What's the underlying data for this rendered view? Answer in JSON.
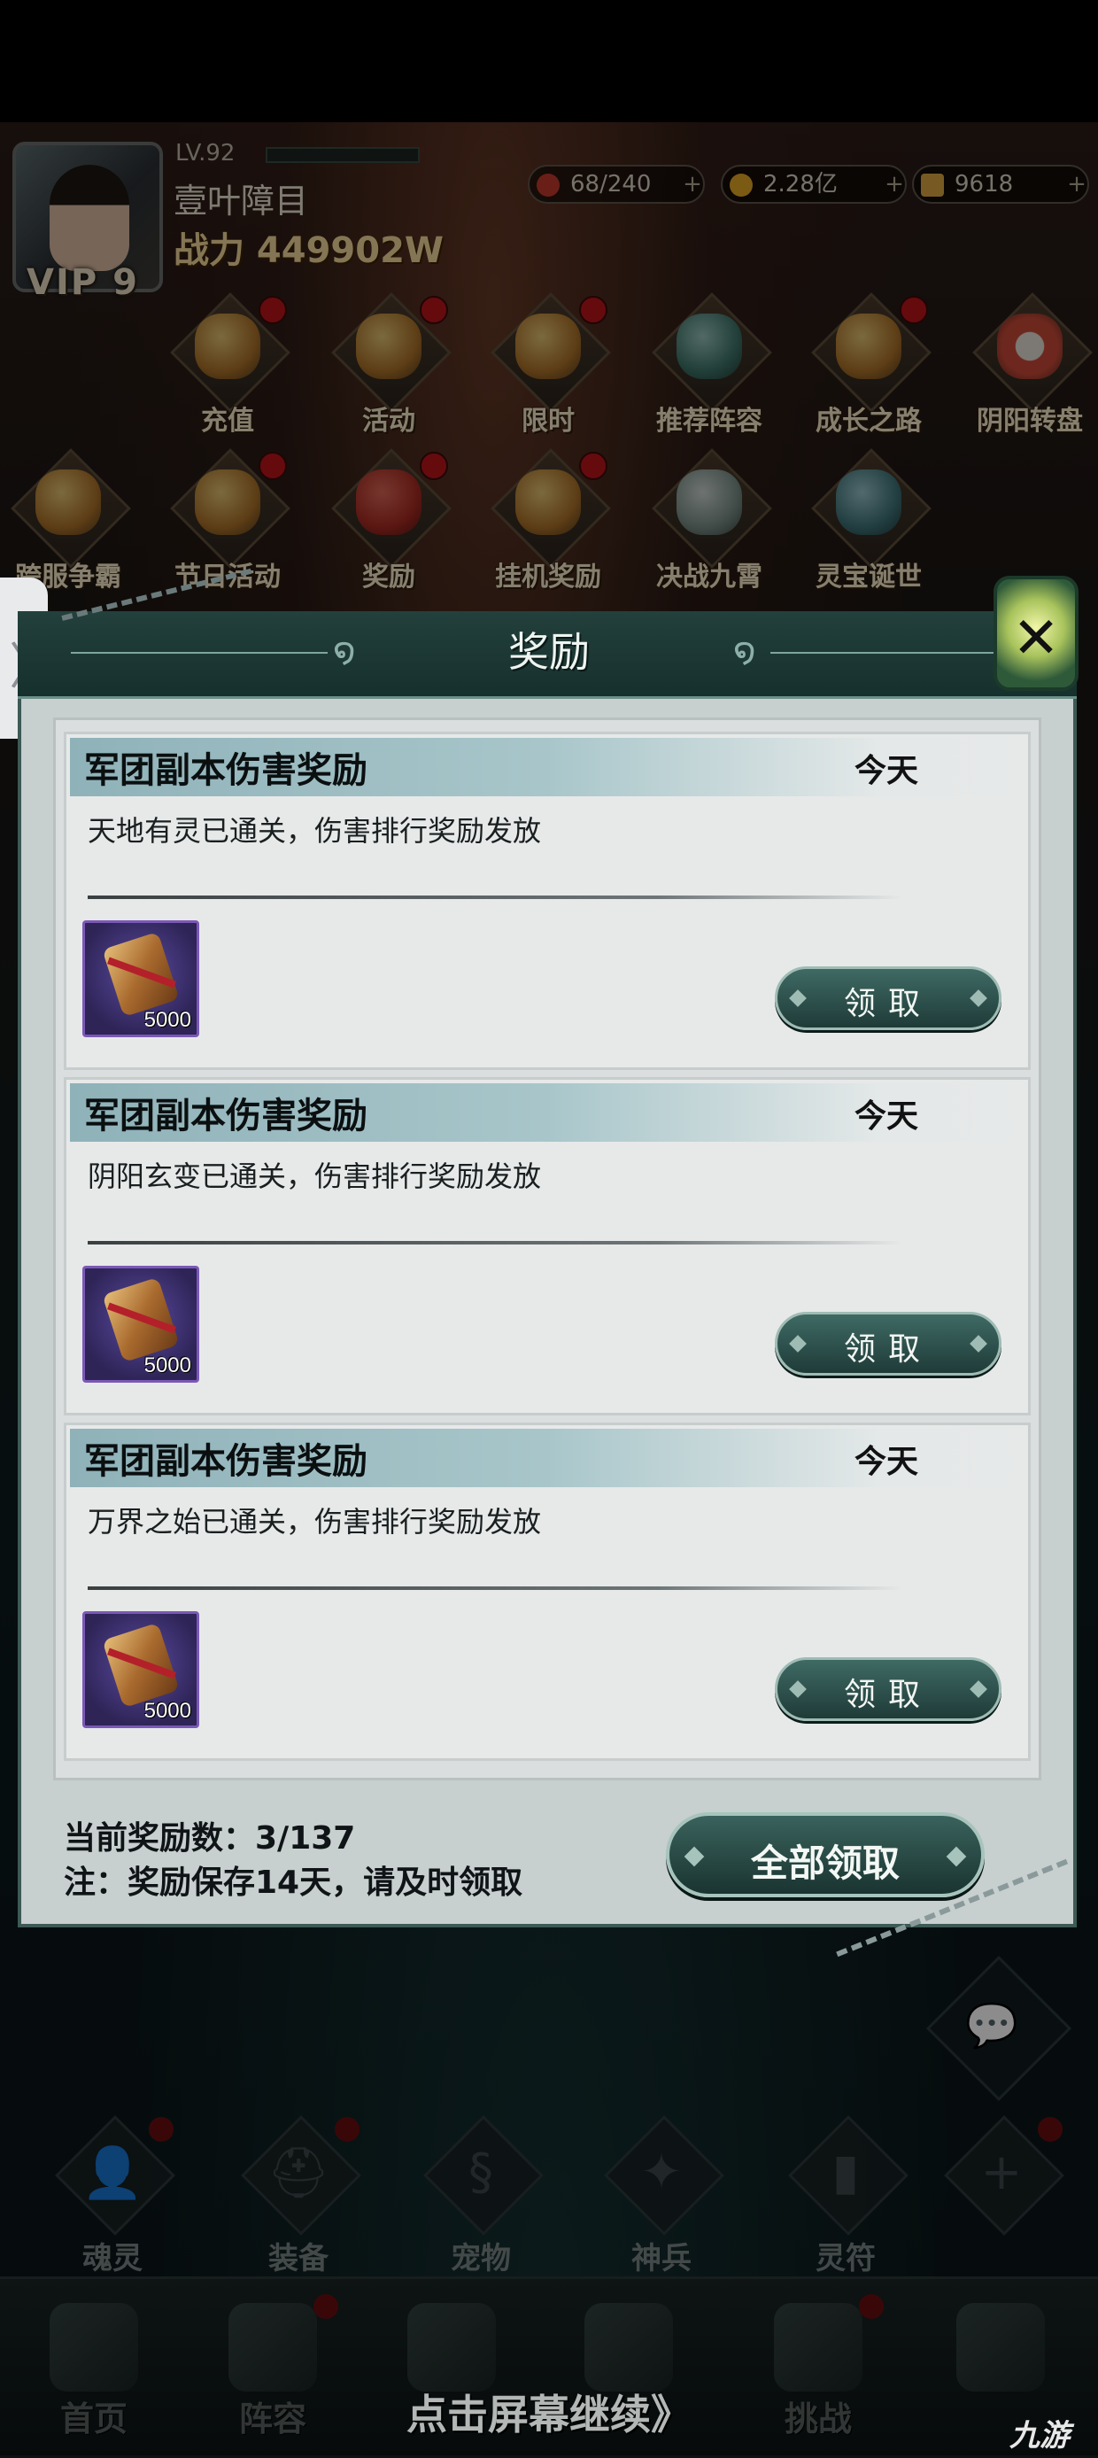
{
  "player": {
    "level": "LV.92",
    "name": "壹叶障目",
    "power": "战力 449902W",
    "vip": "VIP 9"
  },
  "resources": [
    {
      "icon": "stamina-icon",
      "value": "68/240",
      "color": "#c0392b"
    },
    {
      "icon": "gold-coin-icon",
      "value": "2.28亿",
      "color": "#e0a526"
    },
    {
      "icon": "ingot-icon",
      "value": "9618",
      "color": "#d9a441"
    }
  ],
  "activity_icons": [
    {
      "label": "充值",
      "icon": "gold-ingot-icon",
      "dot": true
    },
    {
      "label": "活动",
      "icon": "event-icon",
      "dot": true
    },
    {
      "label": "限时",
      "icon": "limited-time-icon",
      "dot": true
    },
    {
      "label": "推荐阵容",
      "icon": "lineup-icon",
      "dot": false
    },
    {
      "label": "成长之路",
      "icon": "growth-icon",
      "dot": true
    },
    {
      "label": "阴阳转盘",
      "icon": "wheel-icon",
      "dot": false
    },
    {
      "label": "跨服争霸",
      "icon": "crossserver-icon",
      "dot": false
    },
    {
      "label": "节日活动",
      "icon": "festival-icon",
      "dot": true
    },
    {
      "label": "奖励",
      "icon": "gift-icon",
      "dot": true
    },
    {
      "label": "挂机奖励",
      "icon": "idle-reward-icon",
      "dot": true
    },
    {
      "label": "决战九霄",
      "icon": "crossed-swords-icon",
      "dot": false
    },
    {
      "label": "灵宝诞世",
      "icon": "treasure-icon",
      "dot": false
    }
  ],
  "modal": {
    "title": "奖励",
    "rewards": [
      {
        "title": "军团副本伤害奖励",
        "date": "今天",
        "desc": "天地有灵已通关，伤害排行奖励发放",
        "item_icon": "scroll-icon",
        "qty": "5000",
        "button": "领取"
      },
      {
        "title": "军团副本伤害奖励",
        "date": "今天",
        "desc": "阴阳玄变已通关，伤害排行奖励发放",
        "item_icon": "scroll-icon",
        "qty": "5000",
        "button": "领取"
      },
      {
        "title": "军团副本伤害奖励",
        "date": "今天",
        "desc": "万界之始已通关，伤害排行奖励发放",
        "item_icon": "scroll-icon",
        "qty": "5000",
        "button": "领取"
      }
    ],
    "count_text": "当前奖励数：3/137",
    "note_text": "注：奖励保存14天，请及时领取",
    "claim_all": "全部领取"
  },
  "slots": [
    {
      "label": "魂灵",
      "icon": "soul-icon",
      "glyph": "👤",
      "dot": true
    },
    {
      "label": "装备",
      "icon": "helmet-icon",
      "glyph": "⛑",
      "dot": true
    },
    {
      "label": "宠物",
      "icon": "pet-icon",
      "glyph": "§",
      "dot": false
    },
    {
      "label": "神兵",
      "icon": "dagger-icon",
      "glyph": "✦",
      "dot": false
    },
    {
      "label": "灵符",
      "icon": "talisman-icon",
      "glyph": "▮",
      "dot": false
    },
    {
      "label": "",
      "icon": "plus-icon",
      "glyph": "+",
      "dot": true
    }
  ],
  "nav": [
    {
      "label": "首页",
      "icon": "home-icon",
      "dot": false
    },
    {
      "label": "阵容",
      "icon": "lineup-book-icon",
      "dot": true
    },
    {
      "label": "",
      "icon": "weapon-icon",
      "dot": false
    },
    {
      "label": "",
      "icon": "battle-icon",
      "dot": false
    },
    {
      "label": "挑战",
      "icon": "challenge-scroll-icon",
      "dot": true
    },
    {
      "label": "",
      "icon": "mascot-icon",
      "dot": false
    }
  ],
  "continue_text": "点击屏幕继续》",
  "watermark": "九游"
}
